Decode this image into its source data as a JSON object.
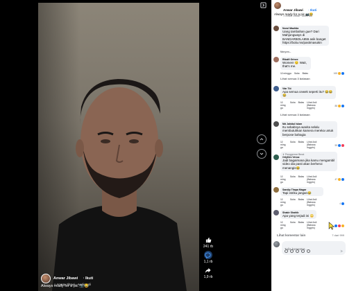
{
  "post": {
    "author": "Anwar Jibawi",
    "follow_label": "· Ikuti",
    "audio": "♫ Anwar Jibawi · Audio asli",
    "caption": "Always ready for a pic 📷😂"
  },
  "video_actions": {
    "likes": "241 rb",
    "comments": "1,1 rb",
    "shares": "1,9 rb"
  },
  "comments": [
    {
      "name": "Nurul Maulida",
      "text": "Uang tambahan gue? Dari Mahjongways di BANDARBOLA855 asik banget https://bola.ms/pastimasukin",
      "time": "Menyem...",
      "reply": "",
      "translate": "",
      "react_count": ""
    },
    {
      "name": "Rikalfi Grinee",
      "text": "Women! 😏 Wait, that's me.",
      "time": "12 minggu",
      "reply": "Suka",
      "reply2": "Balas",
      "translate": "",
      "react_count": "165"
    },
    {
      "name": "Vân Tôi",
      "text": "Apa semua cewek seperti itu? 😂😂😂",
      "time": "12 ming gu",
      "reply": "Suka",
      "reply2": "Balas",
      "translate": "Lihat Asli (Bahasa Inggris)",
      "react_count": "88"
    },
    {
      "name": "Md Jahidul Islam",
      "text": "Itu sebabnya wanita selalu membutuhkan kamera mereka untuk berpose bahagia",
      "time": "12 ming gu",
      "reply": "Suka",
      "reply2": "Balas",
      "translate": "Lihat Asli (Bahasa Inggris)",
      "react_count": "59"
    },
    {
      "name": "OrlyDev Venoz",
      "text": "Jadi bagaimana jika kamu mengambil video dia pasti akan berheroi menangis😂",
      "time": "12 ming gu",
      "reply": "Suka",
      "reply2": "Balas",
      "translate": "Lihat Asli (Bahasa Inggris)",
      "react_count": "47",
      "badge": "✦ Penggemar Berat"
    },
    {
      "name": "Sandip Thapa Magar",
      "text": "Tapi istriku jangan😂",
      "time": "12 ming gu",
      "reply": "Suka",
      "reply2": "Balas",
      "translate": "Lihat Asli (Bahasa Inggris)",
      "react_count": "4"
    },
    {
      "name": "Shakir Shahib",
      "text": "Apa yang terjadi ini 😳",
      "time": "12 ming gu",
      "reply": "Suka",
      "reply2": "Balas",
      "translate": "Lihat Asli (Bahasa Inggris)",
      "react_count": ""
    }
  ],
  "replies_links": [
    "Lihat semua 3 balasan",
    "Lihat semua 3 balasan"
  ],
  "more_comments": "Lihat komentar lain",
  "comment_count": "7 dari 999",
  "input": {
    "placeholder": "Tulis komentar..."
  },
  "colors": {
    "accent": "#1877f2",
    "panel_bg": "#ffffff",
    "bubble_bg": "#f0f2f5",
    "viewer_bg": "#000000"
  }
}
